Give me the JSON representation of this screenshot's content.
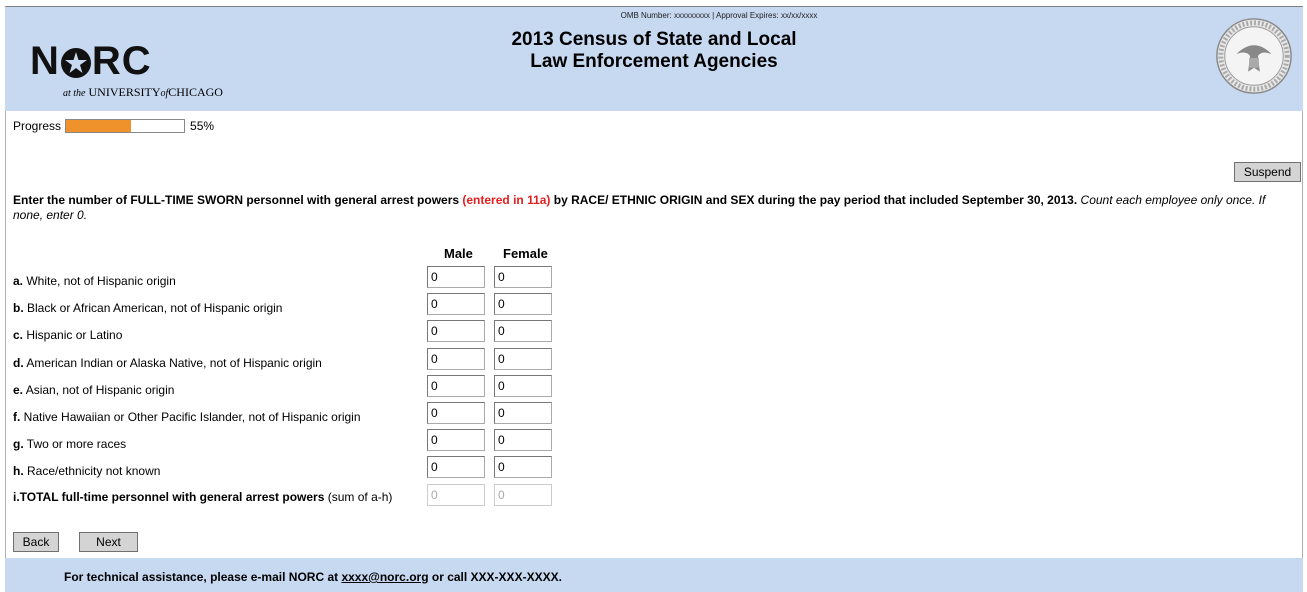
{
  "header": {
    "omb_text": "OMB Number: xxxxxxxxx | Approval Expires: xx/xx/xxxx",
    "title_line1": "2013 Census of State and Local",
    "title_line2": "Law Enforcement Agencies",
    "logo_left_text": "N",
    "logo_right_text": "RC",
    "logo_sub_prefix": "at the",
    "logo_sub_main": "UNIVERSITY",
    "logo_sub_of": "of",
    "logo_sub_city": "CHICAGO"
  },
  "progress": {
    "label": "Progress",
    "value_percent": 55,
    "text": "55%"
  },
  "buttons": {
    "suspend": "Suspend",
    "back": "Back",
    "next": "Next"
  },
  "question": {
    "part1": "Enter the number of FULL-TIME SWORN personnel with general arrest powers ",
    "part2_red": "(entered in 11a)",
    "part3": " by RACE/ ETHNIC ORIGIN and SEX during the pay period that included September 30, 2013.",
    "note": " Count each employee only once. If none, enter 0."
  },
  "columns": {
    "male": "Male",
    "female": "Female"
  },
  "rows": [
    {
      "letter": "a.",
      "label": " White, not of Hispanic origin",
      "male": "0",
      "female": "0"
    },
    {
      "letter": "b.",
      "label": " Black or African American, not of Hispanic origin",
      "male": "0",
      "female": "0"
    },
    {
      "letter": "c.",
      "label": " Hispanic or Latino",
      "male": "0",
      "female": "0"
    },
    {
      "letter": "d.",
      "label": " American Indian or Alaska Native, not of Hispanic origin",
      "male": "0",
      "female": "0"
    },
    {
      "letter": "e.",
      "label": " Asian, not of Hispanic origin",
      "male": "0",
      "female": "0"
    },
    {
      "letter": "f.",
      "label": " Native Hawaiian or Other Pacific Islander, not of Hispanic origin",
      "male": "0",
      "female": "0"
    },
    {
      "letter": "g.",
      "label": " Two or more races",
      "male": "0",
      "female": "0"
    },
    {
      "letter": "h.",
      "label": " Race/ethnicity not known",
      "male": "0",
      "female": "0"
    }
  ],
  "total": {
    "bold_label": "i.TOTAL full-time personnel with general arrest powers",
    "suffix": " (sum of a-h)",
    "male": "0",
    "female": "0"
  },
  "footer": {
    "prefix": "For technical assistance, please e-mail NORC at ",
    "email": "xxxx@norc.org",
    "suffix": " or call XXX-XXX-XXXX."
  },
  "colors": {
    "header_bg": "#c6d9f1",
    "progress_fill": "#f0922b",
    "highlight_red": "#e02020"
  }
}
